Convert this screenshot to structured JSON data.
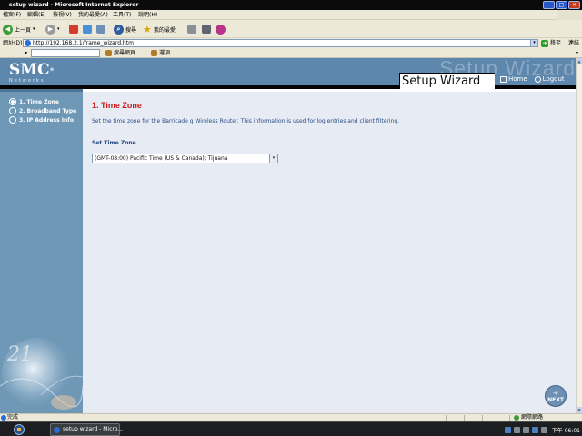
{
  "window": {
    "title": "setup wizard - Microsoft Internet Explorer"
  },
  "menubar": {
    "items": [
      "檔案(F)",
      "編輯(E)",
      "檢視(V)",
      "我的最愛(A)",
      "工具(T)",
      "說明(H)"
    ]
  },
  "toolbar": {
    "back_label": "上一頁",
    "search_label": "搜尋",
    "favorites_label": "我的最愛"
  },
  "address": {
    "label": "網址(D)",
    "url": "http://192.168.2.1/frame_wizard.htm",
    "go_label": "移至",
    "links_label": "連結"
  },
  "searchbar": {
    "search_web_label": "搜尋網頁",
    "options_label": "選項"
  },
  "header": {
    "logo_text": "SMC",
    "logo_reg": "®",
    "logo_sub": "Networks",
    "ghost_title": "Setup Wizard",
    "wizard_title": "Setup Wizard",
    "home_label": "Home",
    "logout_label": "Logout"
  },
  "sidebar": {
    "steps": [
      {
        "label": "1. Time Zone",
        "selected": true
      },
      {
        "label": "2. Broadband Type",
        "selected": false
      },
      {
        "label": "3. IP Address Info",
        "selected": false
      }
    ]
  },
  "main": {
    "title": "1. Time Zone",
    "description": "Set the time zone for the Barricade g Wireless Router. This information is used for log entries and client filtering.",
    "set_time_zone_label": "Set Time Zone",
    "timezone_value": "(GMT-08:00) Pacific Time (US & Canada); Tijuana",
    "next_label": "NEXT"
  },
  "status": {
    "left_text": "完成",
    "zone_text": "網際網路"
  },
  "taskbar": {
    "task_label": "setup wizard - Micro...",
    "clock": "下午 06:01"
  }
}
